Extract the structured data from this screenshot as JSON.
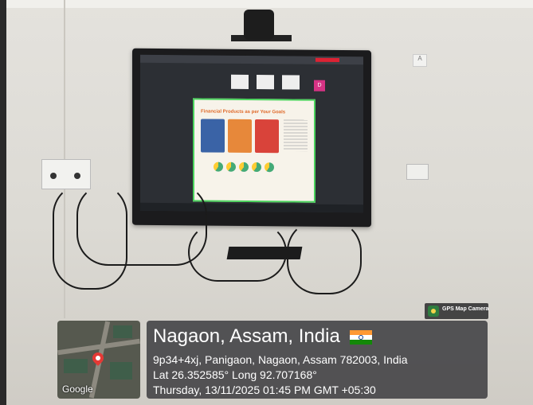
{
  "overlay": {
    "badge_label": "GPS Map Camera",
    "map_attribution": "Google",
    "place_title": "Nagaon, Assam, India",
    "address": "9p34+4xj, Panigaon, Nagaon, Assam 782003, India",
    "coordinates": "Lat 26.352585° Long 92.707168°",
    "timestamp": "Thursday, 13/11/2025 01:45 PM GMT +05:30"
  },
  "screen": {
    "slide_title": "Financial Products as per Your Goals",
    "avatar_letter": "D"
  },
  "wall": {
    "sign_letter": "A"
  }
}
